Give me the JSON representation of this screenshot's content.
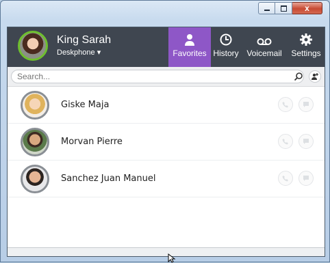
{
  "window": {
    "controls": {
      "minimize": "minimize",
      "maximize": "maximize",
      "close": "x"
    }
  },
  "user": {
    "name": "King Sarah",
    "device": "Deskphone ▾",
    "status_color": "#6fbf2e"
  },
  "tabs": [
    {
      "label": "Favorites",
      "icon": "person-icon",
      "active": true
    },
    {
      "label": "History",
      "icon": "clock-icon",
      "active": false
    },
    {
      "label": "Voicemail",
      "icon": "voicemail-icon",
      "active": false
    },
    {
      "label": "Settings",
      "icon": "gear-icon",
      "active": false
    }
  ],
  "search": {
    "placeholder": "Search..."
  },
  "favorites": [
    {
      "name": "Giske Maja"
    },
    {
      "name": "Morvan Pierre"
    },
    {
      "name": "Sanchez Juan Manuel"
    }
  ],
  "colors": {
    "header_bg": "#3f4650",
    "active_tab": "#8e57c7",
    "presence": "#6fbf2e"
  }
}
